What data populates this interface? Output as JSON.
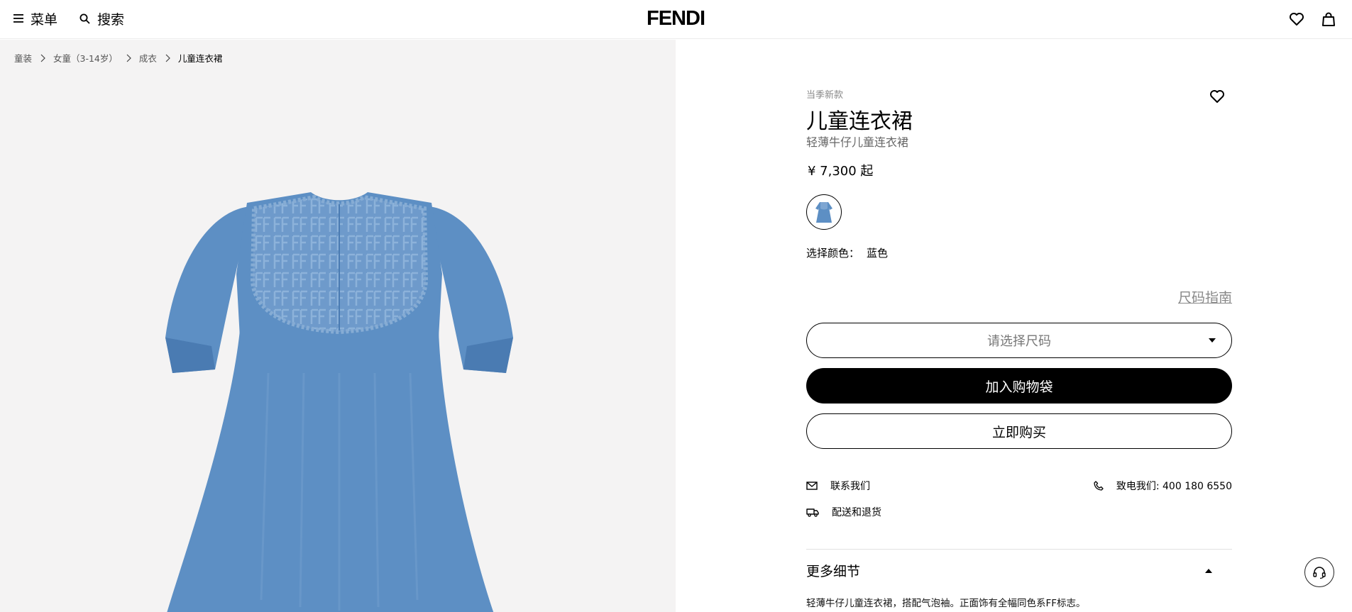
{
  "header": {
    "menu_label": "菜单",
    "search_label": "搜索",
    "logo": "FENDI"
  },
  "breadcrumb": {
    "items": [
      "童装",
      "女童（3-14岁）",
      "成衣"
    ],
    "current": "儿童连衣裙"
  },
  "product": {
    "eyebrow": "当季新款",
    "title": "儿童连衣裙",
    "subtitle": "轻薄牛仔儿童连衣裙",
    "price": "¥ 7,300 起",
    "color_label": "选择颜色：",
    "color_value": "蓝色",
    "size_guide": "尺码指南",
    "size_placeholder": "请选择尺码",
    "add_to_bag": "加入购物袋",
    "buy_now": "立即购买",
    "contact_us": "联系我们",
    "phone_label": "致电我们: 400 180 6550",
    "shipping_returns": "配送和退货",
    "more_details": "更多细节",
    "details_text": "轻薄牛仔儿童连衣裙，搭配气泡袖。正面饰有全幅同色系FF标志。"
  },
  "colors": {
    "denim": "#5d8fc4",
    "denim_dark": "#4a7bb2",
    "gallery_bg": "#f4f3f3"
  },
  "icons": [
    "menu-icon",
    "search-icon",
    "heart-icon",
    "bag-icon",
    "chevron-right-icon",
    "mail-icon",
    "phone-icon",
    "truck-icon",
    "headset-icon"
  ]
}
